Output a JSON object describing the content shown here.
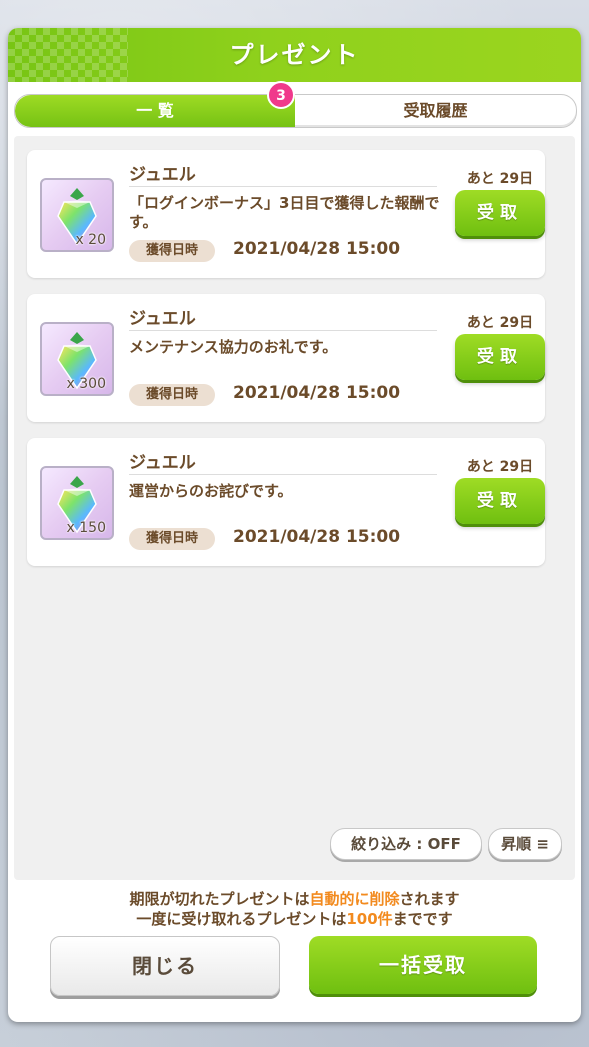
{
  "dialog": {
    "title": "プレゼント"
  },
  "tabs": {
    "list_label": "一 覧",
    "history_label": "受取履歴",
    "badge_count": "3"
  },
  "items": [
    {
      "name": "ジュエル",
      "quantity": "x 20",
      "description": "「ログインボーナス」3日目で獲得した報酬です。",
      "date_label": "獲得日時",
      "date": "2021/04/28 15:00",
      "remaining": "あと 29日",
      "receive_label": "受取"
    },
    {
      "name": "ジュエル",
      "quantity": "x 300",
      "description": "メンテナンス協力のお礼です。",
      "date_label": "獲得日時",
      "date": "2021/04/28 15:00",
      "remaining": "あと 29日",
      "receive_label": "受取"
    },
    {
      "name": "ジュエル",
      "quantity": "x 150",
      "description": "運営からのお詫びです。",
      "date_label": "獲得日時",
      "date": "2021/04/28 15:00",
      "remaining": "あと 29日",
      "receive_label": "受取"
    }
  ],
  "filters": {
    "filter_label": "絞り込み : OFF",
    "sort_label": "昇順"
  },
  "notice": {
    "line1_a": "期限が切れたプレゼントは",
    "line1_highlight": "自動的に削除",
    "line1_b": "されます",
    "line2_a": "一度に受け取れるプレゼントは",
    "line2_highlight": "100件",
    "line2_b": "までです"
  },
  "buttons": {
    "close_label": "閉じる",
    "bulk_receive_label": "一括受取"
  },
  "colors": {
    "accent_green": "#8fd11c",
    "badge_pink": "#f0398b",
    "text_brown": "#6b4b2a",
    "highlight_orange": "#f28a1e"
  }
}
